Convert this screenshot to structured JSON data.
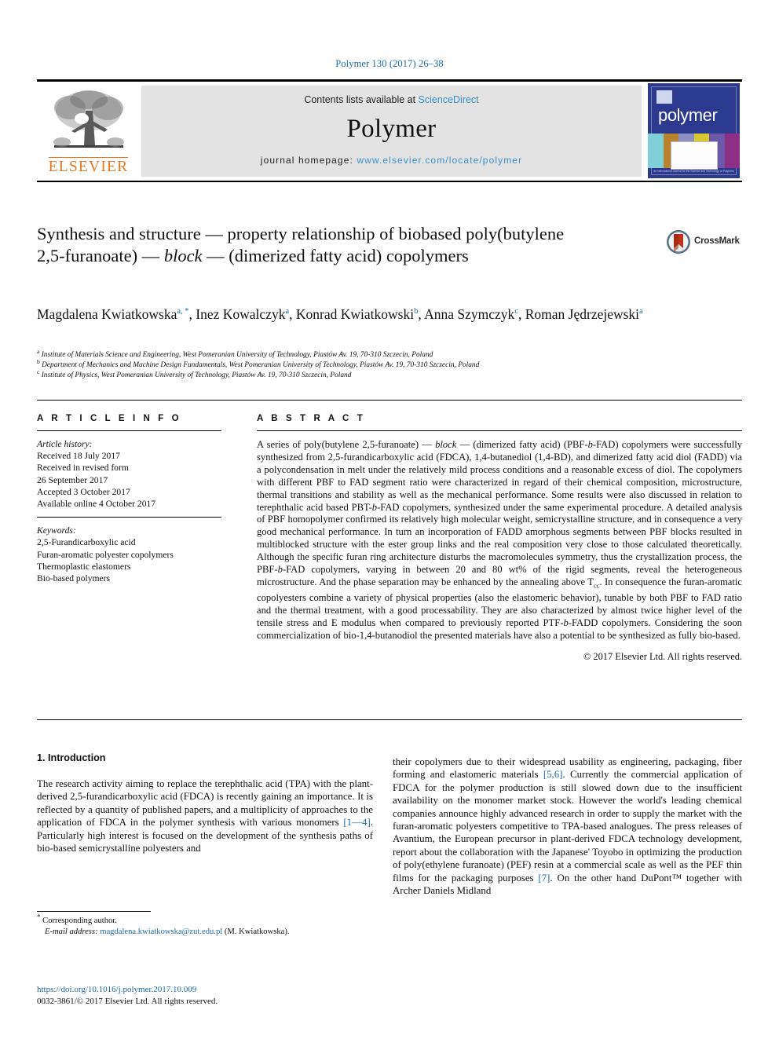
{
  "running_head": "Polymer 130 (2017) 26–38",
  "masthead": {
    "contents_prefix": "Contents lists available at ",
    "sciencedirect": "ScienceDirect",
    "journal_title": "Polymer",
    "homepage_prefix": "journal homepage: ",
    "homepage_url": "www.elsevier.com/locate/polymer",
    "publisher_wordmark": "ELSEVIER",
    "cover": {
      "wordmark": "polymer",
      "caption": "An International Journal for the Science and Technology of Polymers"
    },
    "colors": {
      "link_blue": "#3a8fc8",
      "elsevier_orange": "#e87722",
      "band_grey": "#e3e3e3",
      "cover_blue": "#2b3a8f"
    }
  },
  "crossmark": {
    "label": "CrossMark"
  },
  "title": {
    "part1": "Synthesis and structure — property relationship of biobased poly(butylene 2,5-furanoate) — ",
    "italic": "block",
    "part2": " — (dimerized fatty acid) copolymers"
  },
  "authors": {
    "list": [
      {
        "name": "Magdalena Kwiatkowska",
        "marks": "a, *"
      },
      {
        "name": "Inez Kowalczyk",
        "marks": "a"
      },
      {
        "name": "Konrad Kwiatkowski",
        "marks": "b"
      },
      {
        "name": "Anna Szymczyk",
        "marks": "c"
      },
      {
        "name": "Roman Jędrzejewski",
        "marks": "a"
      }
    ]
  },
  "affiliations": [
    {
      "mark": "a",
      "text": "Institute of Materials Science and Engineering, West Pomeranian University of Technology, Piastów Av. 19, 70-310 Szczecin, Poland"
    },
    {
      "mark": "b",
      "text": "Department of Mechanics and Machine Design Fundamentals, West Pomeranian University of Technology, Piastów Av. 19, 70-310 Szczecin, Poland"
    },
    {
      "mark": "c",
      "text": "Institute of Physics, West Pomeranian University of Technology, Piastów Av. 19, 70-310 Szczecin, Poland"
    }
  ],
  "article_info": {
    "heading": "A R T I C L E   I N F O",
    "history_label": "Article history:",
    "history": [
      "Received 18 July 2017",
      "Received in revised form",
      "26 September 2017",
      "Accepted 3 October 2017",
      "Available online 4 October 2017"
    ],
    "keywords_label": "Keywords:",
    "keywords": [
      "2,5-Furandicarboxylic acid",
      "Furan-aromatic polyester copolymers",
      "Thermoplastic elastomers",
      "Bio-based polymers"
    ]
  },
  "abstract": {
    "heading": "A B S T R A C T",
    "p1_a": "A series of poly(butylene 2,5-furanoate) — ",
    "p1_italic": "block",
    "p1_b": " — (dimerized fatty acid) (PBF-",
    "p1_italic2": "b",
    "p1_c": "-FAD) copolymers were successfully synthesized from 2,5-furandicarboxylic acid (FDCA), 1,4-butanediol (1,4-BD), and dimerized fatty acid diol (FADD) via a polycondensation in melt under the relatively mild process conditions and a reasonable excess of diol. The copolymers with different PBF to FAD segment ratio were characterized in regard of their chemical composition, microstructure, thermal transitions and stability as well as the mechanical performance. Some results were also discussed in relation to terephthalic acid based PBT-",
    "p1_italic3": "b",
    "p1_d": "-FAD copolymers, synthesized under the same experimental procedure. A detailed analysis of PBF homopolymer confirmed its relatively high molecular weight, semicrystalline structure, and in consequence a very good mechanical performance. In turn an incorporation of FADD amorphous segments between PBF blocks resulted in multiblocked structure with the ester group links and the real composition very close to those calculated theoretically. Although the specific furan ring architecture disturbs the macromolecules symmetry, thus the crystallization process, the PBF-",
    "p1_italic4": "b",
    "p1_e": "-FAD copolymers, varying in between 20 and 80 wt% of the rigid segments, reveal the heterogeneous microstructure. And the phase separation may be enhanced by the annealing above T",
    "p1_sub": "cc",
    "p1_f": ". In consequence the furan-aromatic copolyesters combine a variety of physical properties (also the elastomeric behavior), tunable by both PBF to FAD ratio and the thermal treatment, with a good processability. They are also characterized by almost twice higher level of the tensile stress and E modulus when compared to previously reported PTF-",
    "p1_italic5": "b",
    "p1_g": "-FADD copolymers. Considering the soon commercialization of bio-1,4-butanodiol the presented materials have also a potential to be synthesized as fully bio-based.",
    "copyright": "© 2017 Elsevier Ltd. All rights reserved."
  },
  "body": {
    "section_heading": "1. Introduction",
    "left_a": "The research activity aiming to replace the terephthalic acid (TPA) with the plant-derived 2,5-furandicarboxylic acid (FDCA) is recently gaining an importance. It is reflected by a quantity of published papers, and a multiplicity of approaches to the application of FDCA in the polymer synthesis with various monomers ",
    "left_ref1": "[1—4]",
    "left_b": ". Particularly high interest is focused on the development of the synthesis paths of bio-based semicrystalline polyesters and",
    "right_a": "their copolymers due to their widespread usability as engineering, packaging, fiber forming and elastomeric materials ",
    "right_ref1": "[5,6]",
    "right_b": ". Currently the commercial application of FDCA for the polymer production is still slowed down due to the insufficient availability on the monomer market stock. However the world's leading chemical companies announce highly advanced research in order to supply the market with the furan-aromatic polyesters competitive to TPA-based analogues. The press releases of Avantium, the European precursor in plant-derived FDCA technology development, report about the collaboration with the Japanese' Toyobo in optimizing the production of poly(ethylene furanoate) (PEF) resin at a commercial scale as well as the PEF thin films for the packaging purposes ",
    "right_ref2": "[7]",
    "right_c": ". On the other hand DuPont™ together with Archer Daniels Midland"
  },
  "footnote": {
    "corresponding": "Corresponding author.",
    "email_label": "E-mail address:",
    "email": "magdalena.kwiatkowska@zut.edu.pl",
    "email_suffix": "(M. Kwiatkowska)."
  },
  "footer": {
    "doi": "https://doi.org/10.1016/j.polymer.2017.10.009",
    "issn_line": "0032-3861/© 2017 Elsevier Ltd. All rights reserved."
  }
}
